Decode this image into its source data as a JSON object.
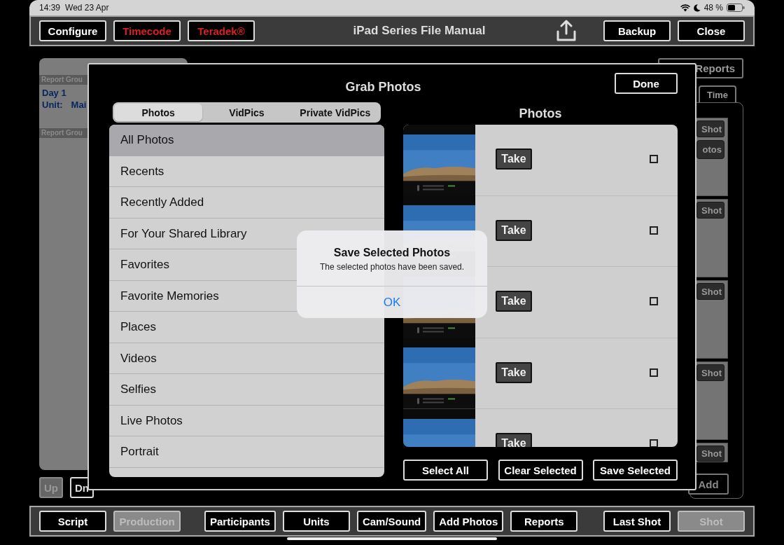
{
  "status_bar": {
    "time": "14:39",
    "date": "Wed 23 Apr",
    "battery": "48 %"
  },
  "toolbar": {
    "left_buttons": [
      {
        "label": "Configure",
        "highlighted": false
      },
      {
        "label": "Timecode",
        "highlighted": true
      },
      {
        "label": "Teradek®",
        "highlighted": true
      }
    ],
    "title": "iPad Series File Manual",
    "right_buttons": [
      {
        "label": "Backup",
        "highlighted": false
      },
      {
        "label": "Close",
        "highlighted": false
      }
    ]
  },
  "left_panel": {
    "groups": [
      {
        "header": "Report Grou",
        "day": "Day 1",
        "unit_label": "Unit:",
        "unit_value": "Mai"
      },
      {
        "header": "Report Grou"
      }
    ],
    "buttons": [
      {
        "label": "Up",
        "disabled": true
      },
      {
        "label": "Dn",
        "disabled": false
      }
    ]
  },
  "right_panel": {
    "reports_button": "Reports",
    "time_tab": "Time",
    "cards": [
      {
        "buttons": [
          {
            "label": "Shot",
            "kind": "shot"
          },
          {
            "label": "otos",
            "kind": "photos"
          }
        ]
      },
      {
        "buttons": [
          {
            "label": "Shot",
            "kind": "shot"
          }
        ]
      },
      {
        "buttons": [
          {
            "label": "Shot",
            "kind": "shot"
          }
        ]
      },
      {
        "buttons": [
          {
            "label": "Shot",
            "kind": "shot"
          }
        ]
      },
      {
        "buttons": [
          {
            "label": "Shot",
            "kind": "shot"
          }
        ]
      }
    ],
    "add_button": "Add"
  },
  "modal": {
    "title": "Grab Photos",
    "done_button": "Done",
    "segments": [
      {
        "label": "Photos",
        "selected": true
      },
      {
        "label": "VidPics",
        "selected": false
      },
      {
        "label": "Private VidPics",
        "selected": false
      }
    ],
    "albums": [
      {
        "label": "All Photos",
        "selected": true
      },
      {
        "label": "Recents",
        "selected": false
      },
      {
        "label": "Recently Added",
        "selected": false
      },
      {
        "label": "For Your Shared Library",
        "selected": false
      },
      {
        "label": "Favorites",
        "selected": false
      },
      {
        "label": "Favorite Memories",
        "selected": false
      },
      {
        "label": "Places",
        "selected": false
      },
      {
        "label": "Videos",
        "selected": false
      },
      {
        "label": "Selfies",
        "selected": false
      },
      {
        "label": "Live Photos",
        "selected": false
      },
      {
        "label": "Portrait",
        "selected": false
      }
    ],
    "photos_title": "Photos",
    "photos": [
      {
        "kind": "picture",
        "take": "Take",
        "checked": false
      },
      {
        "kind": "picture",
        "take": "Take",
        "checked": false
      },
      {
        "kind": "picture",
        "take": "Take",
        "checked": false
      },
      {
        "kind": "picture",
        "take": "Take",
        "checked": false
      },
      {
        "kind": "picture",
        "take": "Take",
        "checked": false
      }
    ],
    "actions": [
      "Select All",
      "Clear Selected",
      "Save Selected"
    ],
    "alert": {
      "title": "Save Selected Photos",
      "message": "The selected photos have been saved.",
      "button": "OK"
    }
  },
  "bottom_toolbar": {
    "groups": [
      [
        {
          "label": "Script",
          "disabled": false
        },
        {
          "label": "Production",
          "disabled": true
        }
      ],
      [
        {
          "label": "Participants",
          "disabled": false
        },
        {
          "label": "Units",
          "disabled": false
        },
        {
          "label": "Cam/Sound",
          "disabled": false
        },
        {
          "label": "Add Photos",
          "disabled": false
        },
        {
          "label": "Reports",
          "disabled": false
        }
      ],
      [
        {
          "label": "Last Shot",
          "disabled": false
        },
        {
          "label": "Shot",
          "disabled": true
        }
      ]
    ]
  }
}
